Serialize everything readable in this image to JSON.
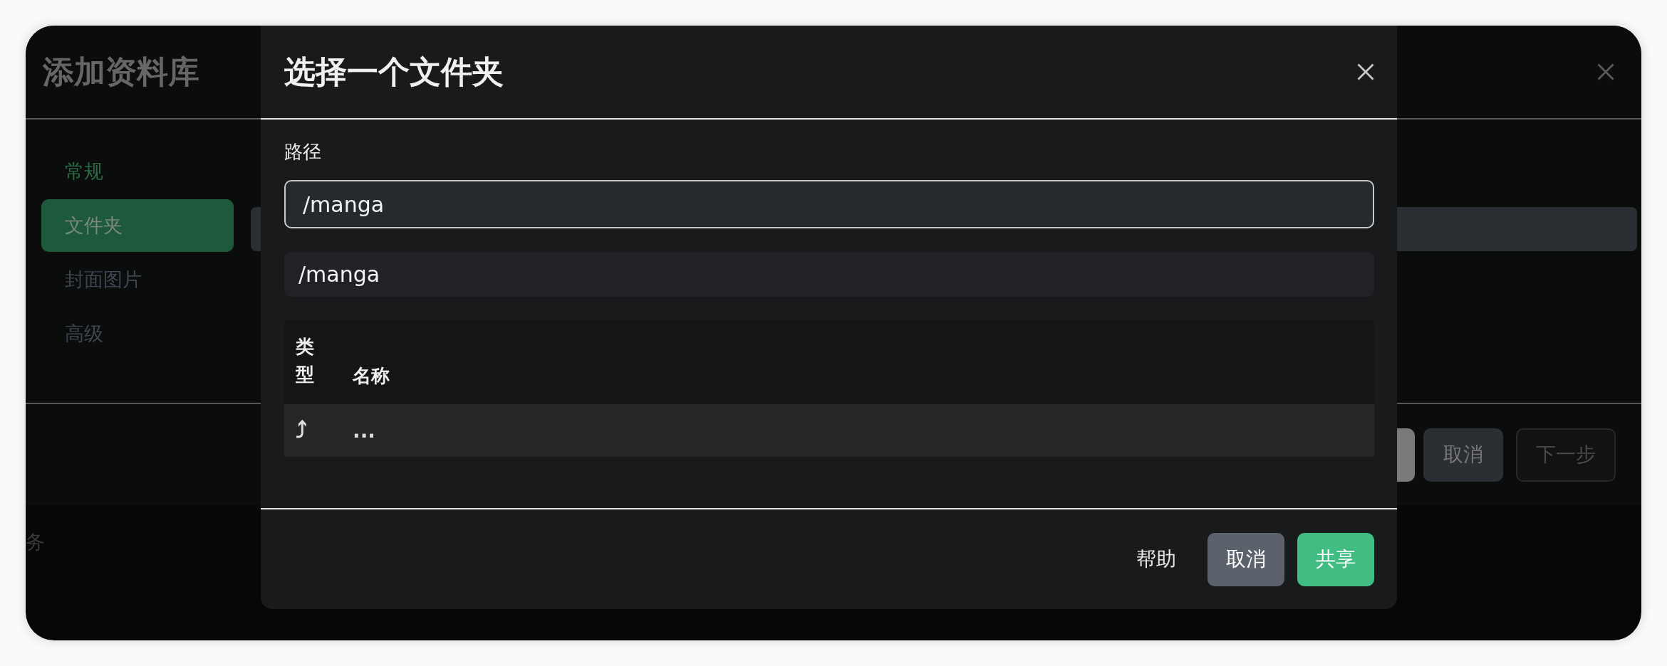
{
  "background_dialog": {
    "title": "添加资料库",
    "tabs": [
      {
        "label": "常规",
        "selected": true,
        "focused": false
      },
      {
        "label": "文件夹",
        "selected": false,
        "focused": true
      },
      {
        "label": "封面图片",
        "selected": false,
        "focused": false
      },
      {
        "label": "高级",
        "selected": false,
        "focused": false
      }
    ],
    "buttons": [
      {
        "label": "取消",
        "disabled": false
      },
      {
        "label": "下一步",
        "disabled": true
      }
    ]
  },
  "behind_text": "务",
  "modal": {
    "title": "选择一个文件夹",
    "path_label": "路径",
    "path_value": "/manga",
    "current_path": "/manga",
    "table": {
      "columns": [
        "类型",
        "名称"
      ],
      "rows": [
        {
          "type_icon": "⤴",
          "name": "..."
        }
      ]
    },
    "buttons": [
      {
        "label": "帮助",
        "kind": "text"
      },
      {
        "label": "取消",
        "kind": "secondary"
      },
      {
        "label": "共享",
        "kind": "primary"
      }
    ]
  }
}
